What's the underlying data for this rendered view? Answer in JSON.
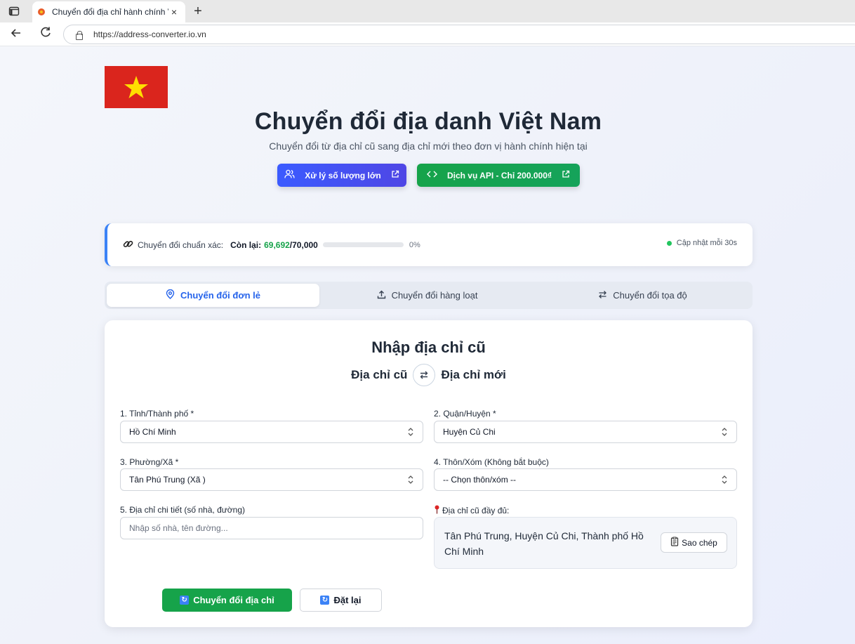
{
  "browser": {
    "tab_title": "Chuyển đổi địa chỉ hành chính Việ",
    "tab_close": "×",
    "new_tab": "+",
    "url": "https://address-converter.io.vn"
  },
  "header": {
    "title": "Chuyển đổi địa danh Việt Nam",
    "subtitle": "Chuyển đổi từ địa chỉ cũ sang địa chỉ mới theo đơn vị hành chính hiện tại",
    "bulk_button": "Xử lý số lượng lớn",
    "api_button": "Dịch vụ API - Chỉ 200.000₫"
  },
  "stats": {
    "label": "Chuyển đổi chuẩn xác:",
    "remaining_label": "Còn lại:",
    "remaining": "69,692",
    "total": "/70,000",
    "progress_fraction": 0,
    "percent": "0%",
    "update_note": "Cập nhật mỗi 30s"
  },
  "tabs": [
    {
      "label": "Chuyển đổi đơn lẻ",
      "icon": "map-pin-icon"
    },
    {
      "label": "Chuyển đổi hàng loạt",
      "icon": "upload-icon"
    },
    {
      "label": "Chuyển đổi tọa độ",
      "icon": "swap-icon"
    }
  ],
  "form": {
    "heading": "Nhập địa chỉ cũ",
    "old_label": "Địa chỉ cũ",
    "new_label": "Địa chỉ mới",
    "province_label": "1. Tỉnh/Thành phố *",
    "province_value": "Hồ Chí Minh",
    "district_label": "2. Quận/Huyện *",
    "district_value": "Huyện Củ Chi",
    "ward_label": "3. Phường/Xã *",
    "ward_value": "Tân Phú Trung (Xã )",
    "hamlet_label": "4. Thôn/Xóm (Không bắt buộc)",
    "hamlet_value": "-- Chọn thôn/xóm --",
    "detail_label": "5. Địa chỉ chi tiết (số nhà, đường)",
    "detail_placeholder": "Nhập số nhà, tên đường...",
    "full_label": "Địa chỉ cũ đầy đủ:",
    "full_value": "Tân Phú Trung, Huyện Củ Chi, Thành phố Hồ Chí Minh",
    "copy_button": "Sao chép",
    "convert_button": "Chuyển đổi địa chỉ",
    "reset_button": "Đặt lại"
  },
  "colors": {
    "primary_blue": "#2563eb",
    "green": "#16a34a",
    "flag_red": "#da251d",
    "flag_star": "#ffde00"
  }
}
